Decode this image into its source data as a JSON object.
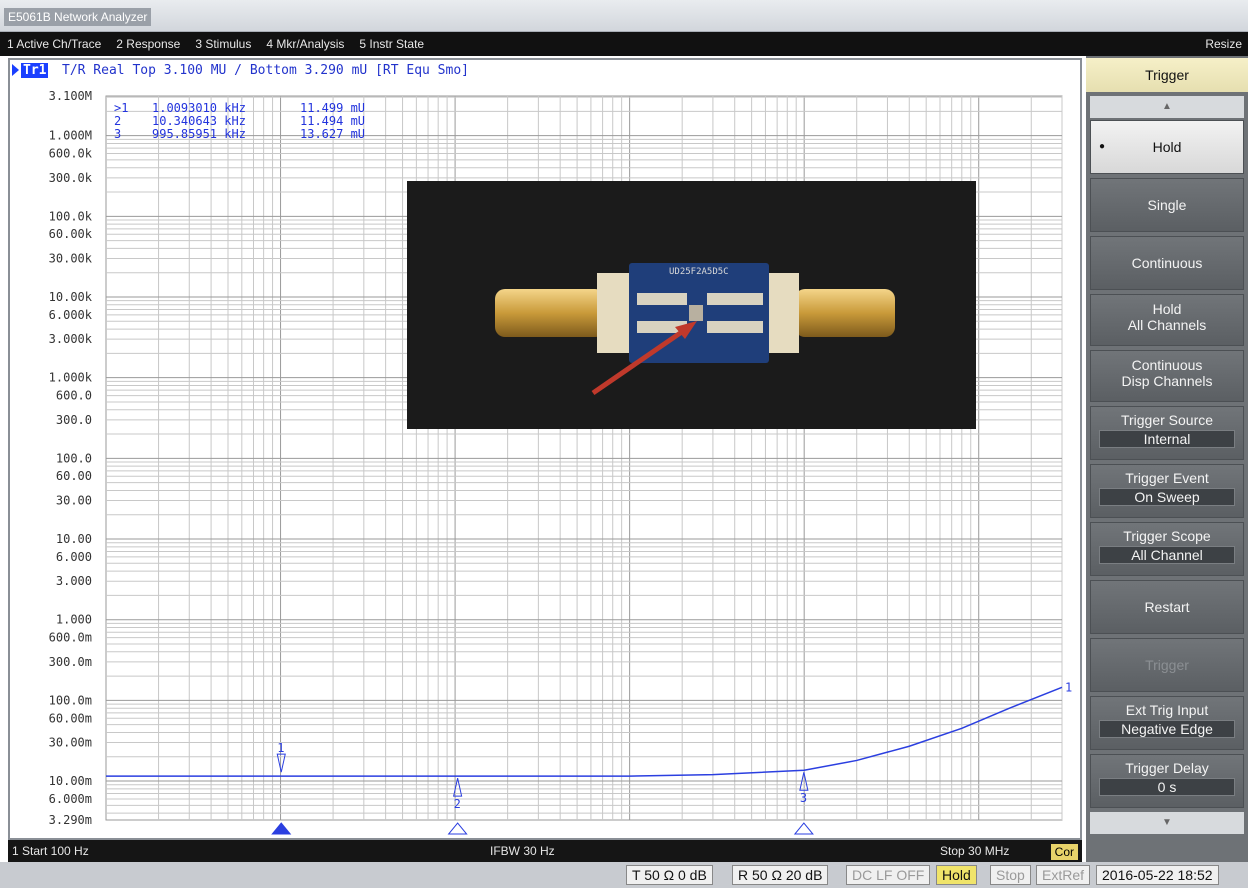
{
  "window": {
    "title": "E5061B Network Analyzer"
  },
  "menu": {
    "items": [
      "1 Active Ch/Trace",
      "2 Response",
      "3 Stimulus",
      "4 Mkr/Analysis",
      "5 Instr State"
    ],
    "resize": "Resize"
  },
  "trace": {
    "badge": "Tr1",
    "header": "T/R Real Top 3.100 MU / Bottom 3.290 mU [RT Equ Smo]"
  },
  "chart_data": {
    "type": "line",
    "y_scale": "log",
    "ylim_labels": [
      "3.100M",
      "3.290m"
    ],
    "y_tick_labels": [
      {
        "label": "3.100M",
        "v": 3100000
      },
      {
        "label": "1.000M",
        "v": 1000000
      },
      {
        "label": "600.0k",
        "v": 600000
      },
      {
        "label": "300.0k",
        "v": 300000
      },
      {
        "label": "100.0k",
        "v": 100000
      },
      {
        "label": "60.00k",
        "v": 60000
      },
      {
        "label": "30.00k",
        "v": 30000
      },
      {
        "label": "10.00k",
        "v": 10000
      },
      {
        "label": "6.000k",
        "v": 6000
      },
      {
        "label": "3.000k",
        "v": 3000
      },
      {
        "label": "1.000k",
        "v": 1000
      },
      {
        "label": "600.0",
        "v": 600
      },
      {
        "label": "300.0",
        "v": 300
      },
      {
        "label": "100.0",
        "v": 100
      },
      {
        "label": "60.00",
        "v": 60
      },
      {
        "label": "30.00",
        "v": 30
      },
      {
        "label": "10.00",
        "v": 10
      },
      {
        "label": "6.000",
        "v": 6
      },
      {
        "label": "3.000",
        "v": 3
      },
      {
        "label": "1.000",
        "v": 1
      },
      {
        "label": "600.0m",
        "v": 0.6
      },
      {
        "label": "300.0m",
        "v": 0.3
      },
      {
        "label": "100.0m",
        "v": 0.1
      },
      {
        "label": "60.00m",
        "v": 0.06
      },
      {
        "label": "30.00m",
        "v": 0.03
      },
      {
        "label": "10.00m",
        "v": 0.01
      },
      {
        "label": "6.000m",
        "v": 0.006
      },
      {
        "label": "3.290m",
        "v": 0.00329
      }
    ],
    "x_range_hz": [
      100,
      30000000
    ],
    "series": [
      {
        "points": [
          [
            100,
            0.0115
          ],
          [
            1000,
            0.0115
          ],
          [
            10000,
            0.0115
          ],
          [
            100000,
            0.0115
          ],
          [
            300000,
            0.012
          ],
          [
            1000000,
            0.0136
          ],
          [
            2000000,
            0.018
          ],
          [
            4000000,
            0.027
          ],
          [
            8000000,
            0.045
          ],
          [
            15000000,
            0.08
          ],
          [
            30000000,
            0.145
          ]
        ]
      }
    ],
    "markers": [
      {
        "id": "1",
        "freq_hz": 1009.301,
        "value": 0.011499
      },
      {
        "id": "2",
        "freq_hz": 10340.643,
        "value": 0.011494
      },
      {
        "id": "3",
        "freq_hz": 995859.51,
        "value": 0.013627
      }
    ],
    "end_marker": "1"
  },
  "marker_table": [
    {
      "num": ">1",
      "freq": "1.0093010 kHz",
      "val": "11.499 mU"
    },
    {
      "num": " 2",
      "freq": "10.340643 kHz",
      "val": "11.494 mU"
    },
    {
      "num": " 3",
      "freq": "995.85951 kHz",
      "val": "13.627 mU"
    }
  ],
  "channel_status": {
    "start": "1  Start 100 Hz",
    "ifbw": "IFBW 30 Hz",
    "stop": "Stop 30 MHz",
    "cor": "Cor"
  },
  "system_status": {
    "t_rx": "T 50 Ω 0 dB",
    "r_rx": "R 50 Ω 20 dB",
    "dc_lf": "DC LF OFF",
    "hold": "Hold",
    "stop": "Stop",
    "extref": "ExtRef",
    "datetime": "2016-05-22 18:52"
  },
  "softkeys": {
    "title": "Trigger",
    "up": "▲",
    "down": "▼",
    "hold": "Hold",
    "single": "Single",
    "continuous": "Continuous",
    "hold_all_1": "Hold",
    "hold_all_2": "All Channels",
    "cont_disp_1": "Continuous",
    "cont_disp_2": "Disp Channels",
    "trig_source": "Trigger Source",
    "trig_source_val": "Internal",
    "trig_event": "Trigger Event",
    "trig_event_val": "On Sweep",
    "trig_scope": "Trigger Scope",
    "trig_scope_val": "All Channel",
    "restart": "Restart",
    "trigger": "Trigger",
    "ext_trig": "Ext Trig Input",
    "ext_trig_val": "Negative Edge",
    "trig_delay": "Trigger Delay",
    "trig_delay_val": "0 s"
  },
  "photo_label": "UD25F2A5D5C",
  "colors": {
    "trace": "#2b3fe0",
    "grid": "#c8c8c8",
    "panel": "#6e7276",
    "hold_key": "#f0e46a"
  }
}
